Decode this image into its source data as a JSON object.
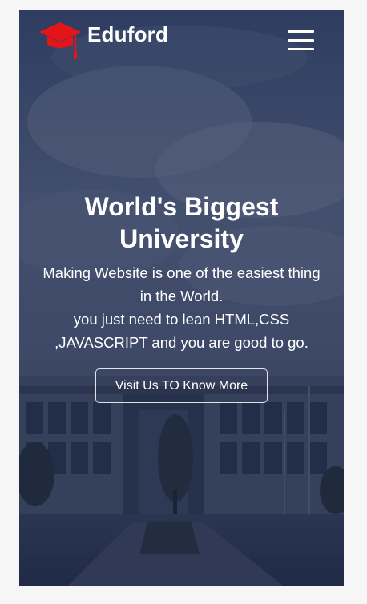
{
  "header": {
    "brand": "Eduford",
    "logo_icon": "graduation-cap-icon",
    "menu_icon": "hamburger-menu-icon"
  },
  "hero": {
    "title": "World's Biggest University",
    "text_lines": [
      "Making Website is one of the easiest thing",
      "in the World.",
      "you just need to lean HTML,CSS",
      ",JAVASCRIPT and you are good to go."
    ],
    "cta_label": "Visit Us TO Know More"
  },
  "colors": {
    "accent_red": "#e4141b",
    "overlay": "#0a163a",
    "text": "#ffffff"
  }
}
